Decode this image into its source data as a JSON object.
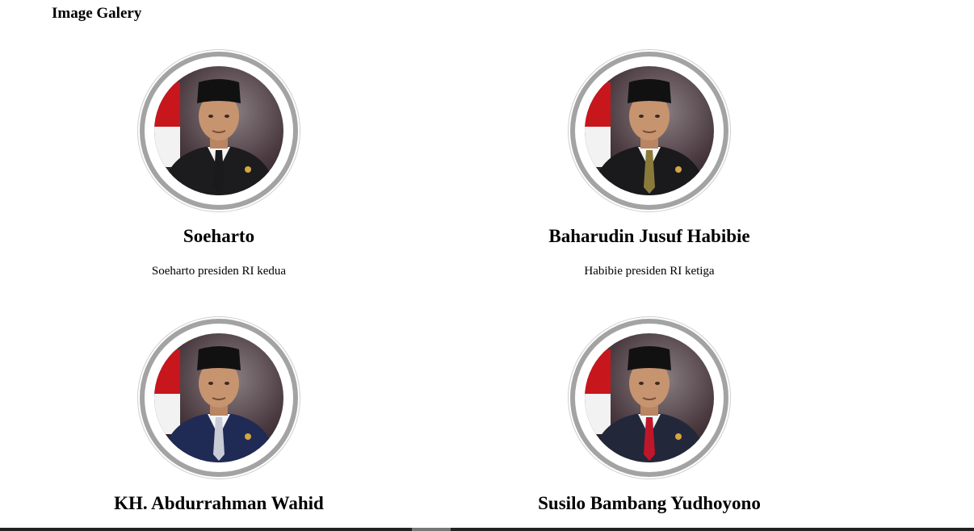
{
  "page": {
    "title": "Image Galery"
  },
  "gallery": [
    {
      "name": "Soeharto",
      "description": "Soeharto presiden RI kedua",
      "tie": "#1a1a1a",
      "suit": "#1c1c1f"
    },
    {
      "name": "Baharudin Jusuf Habibie",
      "description": "Habibie presiden RI ketiga",
      "tie": "#8a7a3a",
      "suit": "#1a1a1d"
    },
    {
      "name": "KH. Abdurrahman Wahid",
      "description": "",
      "tie": "#c9ccd6",
      "suit": "#1f2a55"
    },
    {
      "name": "Susilo Bambang Yudhoyono",
      "description": "",
      "tie": "#c0162a",
      "suit": "#22283a"
    }
  ],
  "colors": {
    "ring": "#a3a3a3",
    "background_flag_red": "#c8161d"
  }
}
